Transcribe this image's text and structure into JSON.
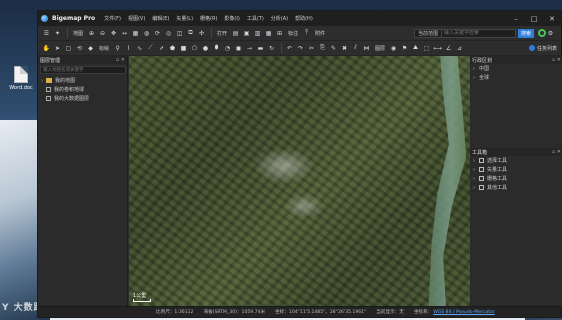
{
  "desktop": {
    "icon_label": "Word.doc",
    "watermark": "Y 大数跨境"
  },
  "app": {
    "title": "Bigemap Pro",
    "menu": [
      "文件(F)",
      "视图(V)",
      "编辑(E)",
      "矢量(L)",
      "栅格(R)",
      "影像(I)",
      "工具(T)",
      "分析(A)",
      "帮助(H)"
    ]
  },
  "toolbar1": {
    "labels": [
      "地图",
      "打开",
      "标注",
      "附件"
    ],
    "search_scope": "当前范围",
    "search_placeholder": "输入关键字检索",
    "search_button": "搜索"
  },
  "toolbar2": {
    "labels": [
      "标绘",
      "图层"
    ],
    "task_button": "任务列表"
  },
  "left_panel": {
    "title": "图层管理",
    "search_placeholder": "输入地图名或关键字",
    "layers": [
      "我的地图",
      "我的卷积地球",
      "我的大数据图层"
    ]
  },
  "map": {
    "scale_label": "1公里"
  },
  "right_panel": {
    "section1_title": "行政区划",
    "regions": [
      "中国",
      "全球"
    ],
    "section2_title": "工具箱",
    "tools": [
      "选择工具",
      "矢量工具",
      "栅格工具",
      "其他工具"
    ]
  },
  "status": {
    "scale": "比例尺：1:36112",
    "elevation": "海拔(SRTM_30)：1059.74米",
    "coords": "坐标：104°11'5.1485\"，28°26'35.1961\"",
    "current_value": "当前显示：无",
    "crs_label": "坐标系：",
    "crs": "WGS 84 / Pseudo-Mercator"
  }
}
